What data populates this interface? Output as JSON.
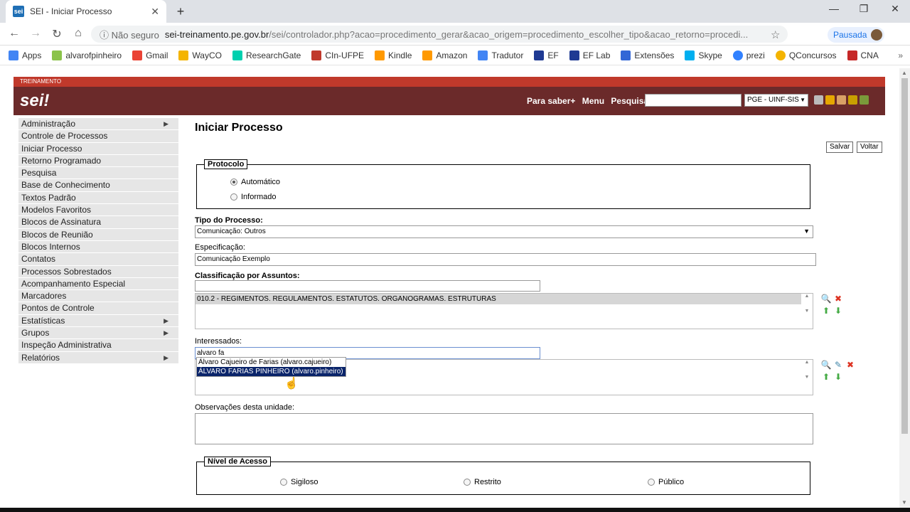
{
  "browser": {
    "tab_title": "SEI - Iniciar Processo",
    "favicon": "sei",
    "new_tab": "+",
    "security": "ⓘ Não seguro",
    "url_host": "sei-treinamento.pe.gov.br",
    "url_path": "/sei/controlador.php?acao=procedimento_gerar&acao_origem=procedimento_escolher_tipo&acao_retorno=procedi...",
    "profile": "Pausada",
    "bookmarks": [
      "Apps",
      "alvarofpinheiro",
      "Gmail",
      "WayCO",
      "ResearchGate",
      "CIn-UFPE",
      "Kindle",
      "Amazon",
      "Tradutor",
      "EF",
      "EF Lab",
      "Extensões",
      "Skype",
      "prezi",
      "QConcursos",
      "CNA"
    ]
  },
  "sei": {
    "env_label": "TREINAMENTO",
    "logo": "sei!",
    "links": [
      "Para saber+",
      "Menu",
      "Pesquisa"
    ],
    "unit": "PGE - UINF-SIS"
  },
  "menu": [
    {
      "label": "Administração",
      "arrow": "▶"
    },
    {
      "label": "Controle de Processos",
      "arrow": ""
    },
    {
      "label": "Iniciar Processo",
      "arrow": ""
    },
    {
      "label": "Retorno Programado",
      "arrow": ""
    },
    {
      "label": "Pesquisa",
      "arrow": ""
    },
    {
      "label": "Base de Conhecimento",
      "arrow": ""
    },
    {
      "label": "Textos Padrão",
      "arrow": ""
    },
    {
      "label": "Modelos Favoritos",
      "arrow": ""
    },
    {
      "label": "Blocos de Assinatura",
      "arrow": ""
    },
    {
      "label": "Blocos de Reunião",
      "arrow": ""
    },
    {
      "label": "Blocos Internos",
      "arrow": ""
    },
    {
      "label": "Contatos",
      "arrow": ""
    },
    {
      "label": "Processos Sobrestados",
      "arrow": ""
    },
    {
      "label": "Acompanhamento Especial",
      "arrow": ""
    },
    {
      "label": "Marcadores",
      "arrow": ""
    },
    {
      "label": "Pontos de Controle",
      "arrow": ""
    },
    {
      "label": "Estatísticas",
      "arrow": "▶"
    },
    {
      "label": "Grupos",
      "arrow": "▶"
    },
    {
      "label": "Inspeção Administrativa",
      "arrow": ""
    },
    {
      "label": "Relatórios",
      "arrow": "▶"
    }
  ],
  "form": {
    "title": "Iniciar Processo",
    "save": "Salvar",
    "back": "Voltar",
    "protocolo_legend": "Protocolo",
    "auto": "Automático",
    "informado": "Informado",
    "tipo_label": "Tipo do Processo:",
    "tipo_value": "Comunicação: Outros",
    "espec_label": "Especificação:",
    "espec_value": "Comunicação Exemplo",
    "class_label": "Classificação por Assuntos:",
    "class_item": "010.2 - REGIMENTOS. REGULAMENTOS. ESTATUTOS. ORGANOGRAMAS. ESTRUTURAS",
    "interessados_label": "Interessados:",
    "interessados_value": "alvaro fa",
    "suggestion_1": "Álvaro Cajueiro de Farias (alvaro.cajueiro)",
    "suggestion_2": "ÁLVARO FARIAS PINHEIRO (alvaro.pinheiro)",
    "obs_label": "Observações desta unidade:",
    "nivel_legend": "Nível de Acesso",
    "sigiloso": "Sigiloso",
    "restrito": "Restrito",
    "publico": "Público"
  }
}
